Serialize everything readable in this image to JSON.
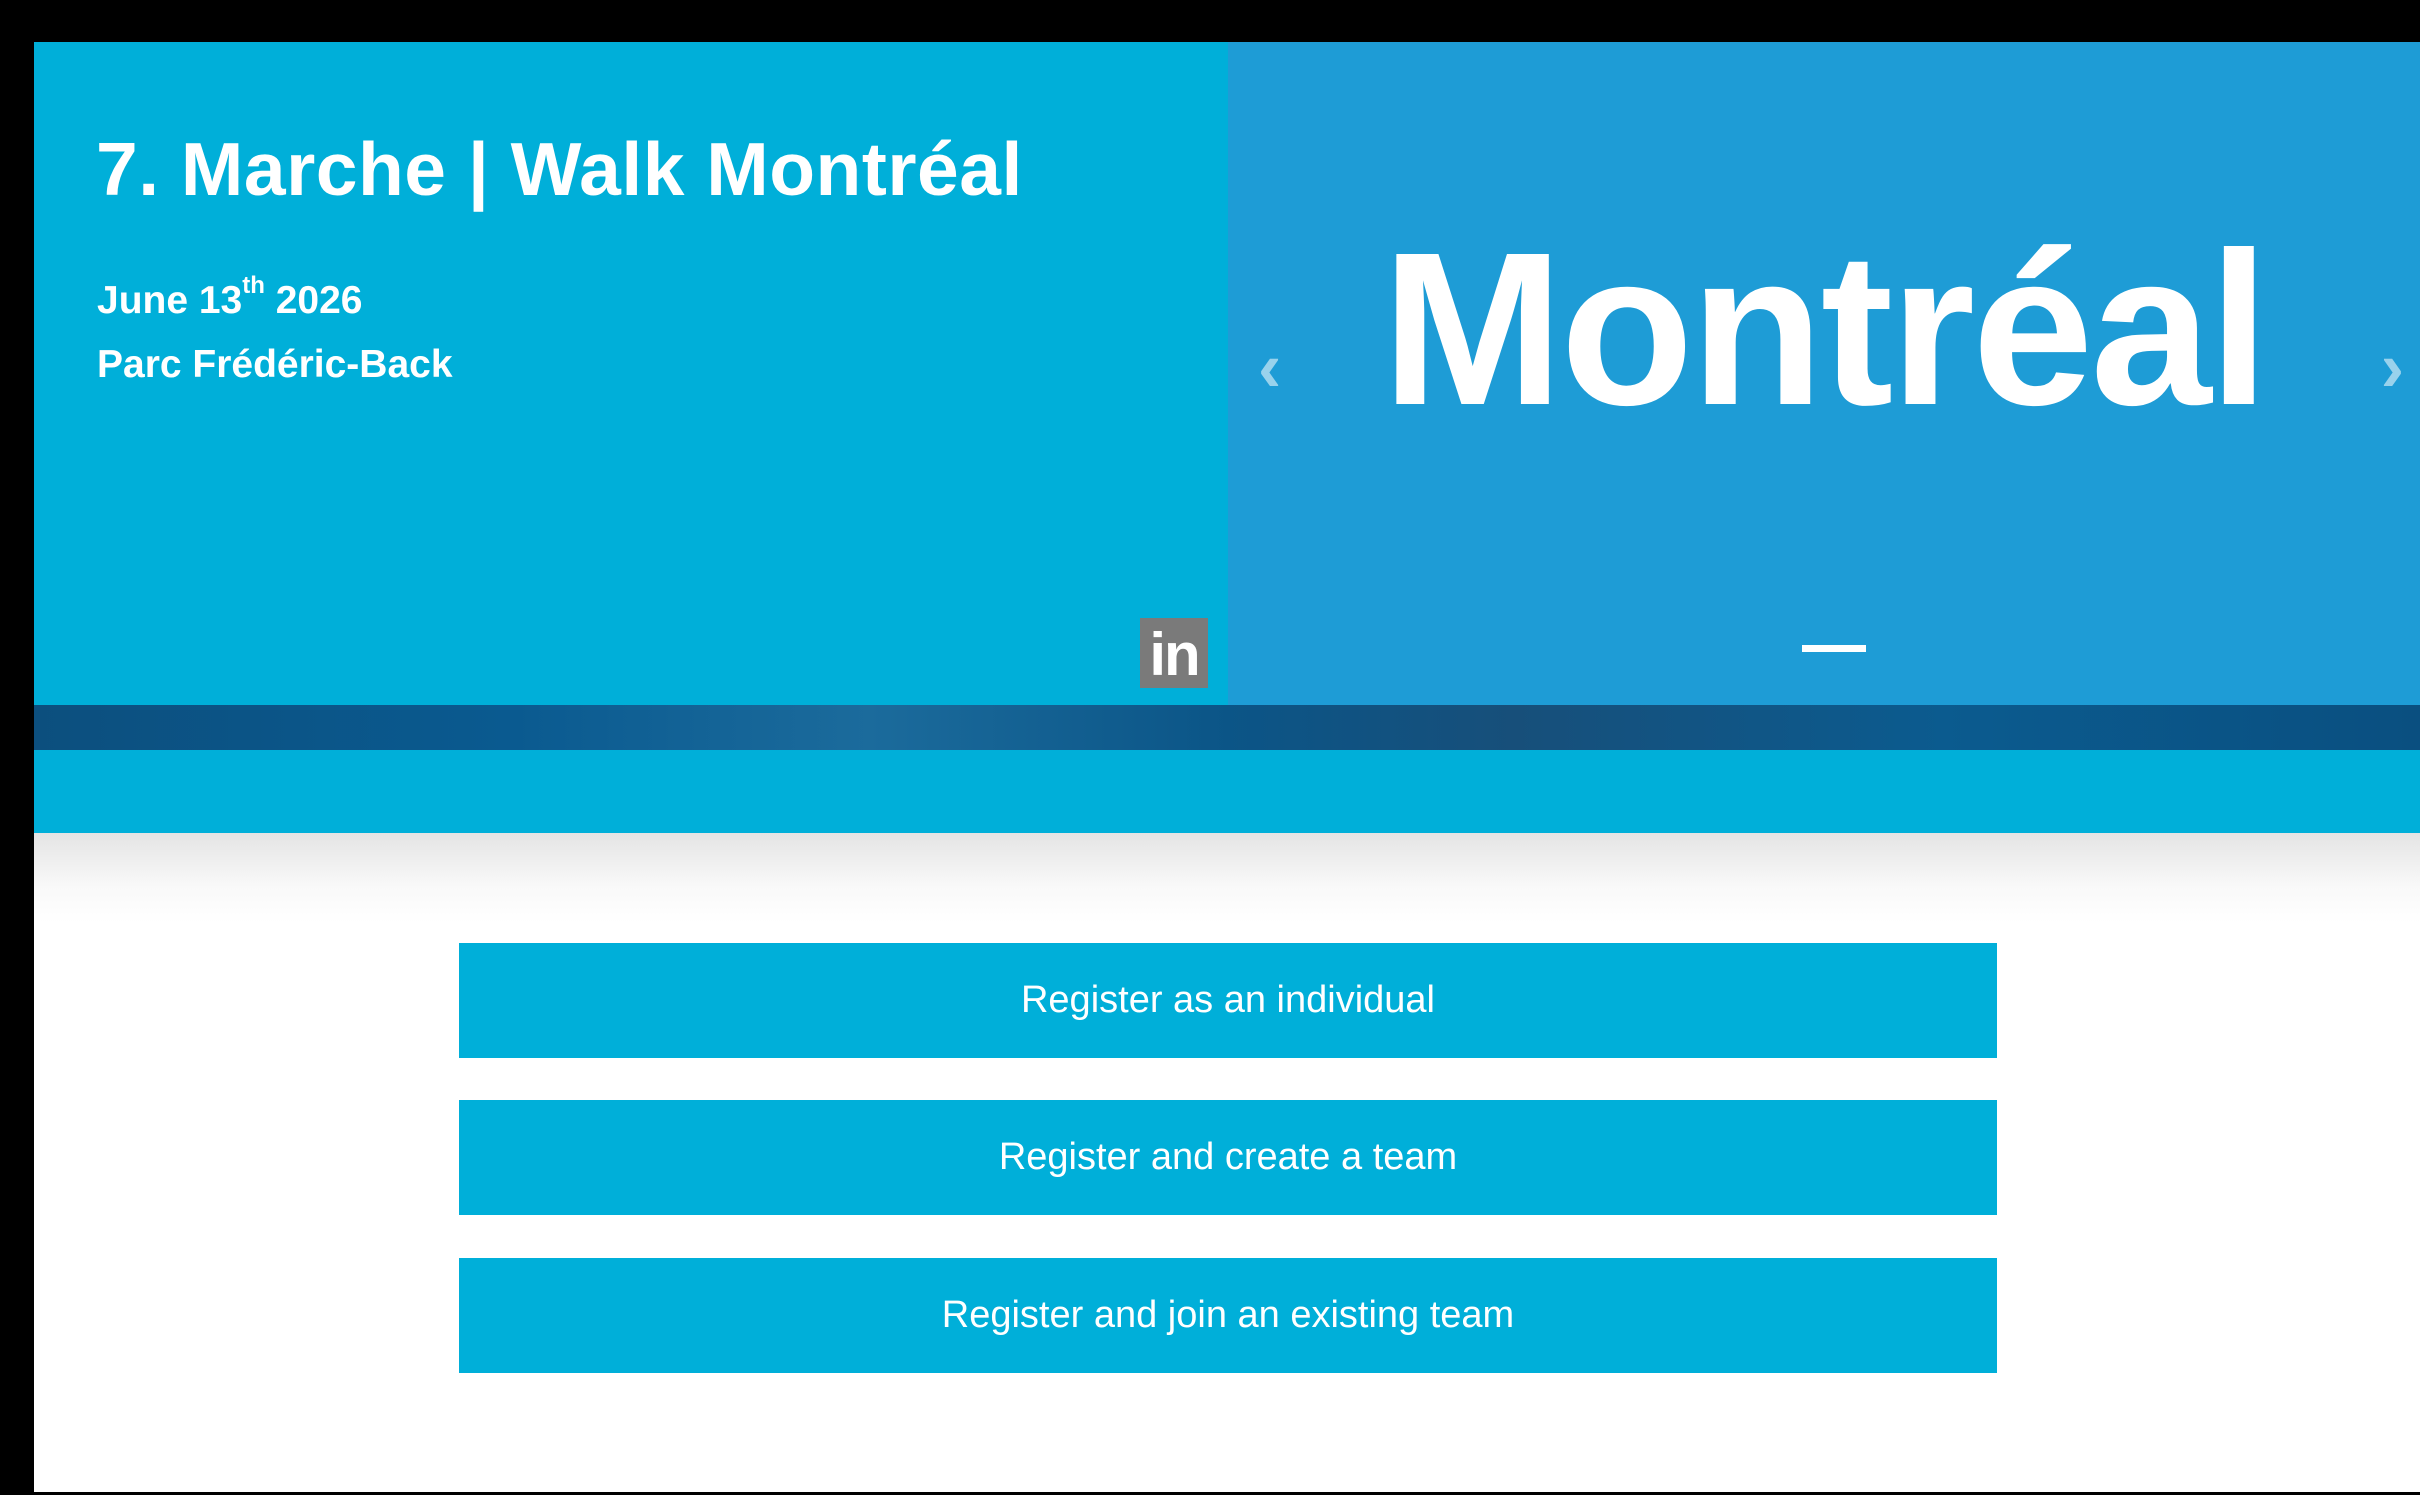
{
  "event": {
    "title": "7. Marche | Walk Montréal",
    "date_prefix": "June 13",
    "date_suffix": "th",
    "date_year": " 2026",
    "location": "Parc Frédéric-Back",
    "social_label": "in"
  },
  "carousel": {
    "city": "Montréal",
    "prev_label": "‹",
    "next_label": "›"
  },
  "registration": {
    "individual_label": "Register as an individual",
    "create_team_label": "Register and create a team",
    "join_team_label": "Register and join an existing team"
  },
  "colors": {
    "primary": "#00afd9",
    "carousel_bg": "#1e9cd6",
    "social_bg": "#7a7a7a"
  }
}
